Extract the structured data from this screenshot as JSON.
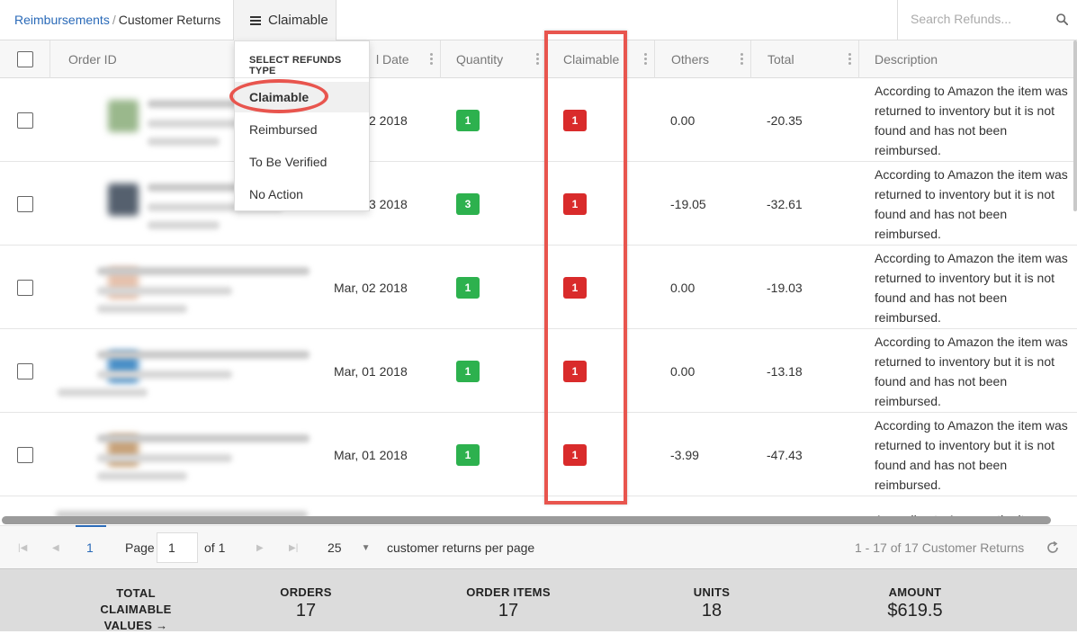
{
  "breadcrumb": {
    "parent": "Reimbursements",
    "separator": "/",
    "current": "Customer Returns"
  },
  "type_button": {
    "label": "Claimable"
  },
  "search": {
    "placeholder": "Search Refunds..."
  },
  "dropdown": {
    "title": "SELECT REFUNDS TYPE",
    "items": [
      "Claimable",
      "Reimbursed",
      "To Be Verified",
      "No Action"
    ],
    "selected": "Claimable"
  },
  "columns": {
    "order_id": "Order ID",
    "date": "l Date",
    "quantity": "Quantity",
    "claimable": "Claimable",
    "others": "Others",
    "total": "Total",
    "description": "Description"
  },
  "rows": [
    {
      "date": "2 2018",
      "quantity": "1",
      "claimable": "1",
      "others": "0.00",
      "total": "-20.35",
      "description": "According to Amazon the item was returned to inventory but it is not found and has not been reimbursed."
    },
    {
      "date": "3 2018",
      "quantity": "3",
      "claimable": "1",
      "others": "-19.05",
      "total": "-32.61",
      "description": "According to Amazon the item was returned to inventory but it is not found and has not been reimbursed."
    },
    {
      "date": "Mar, 02 2018",
      "quantity": "1",
      "claimable": "1",
      "others": "0.00",
      "total": "-19.03",
      "description": "According to Amazon the item was returned to inventory but it is not found and has not been reimbursed."
    },
    {
      "date": "Mar, 01 2018",
      "quantity": "1",
      "claimable": "1",
      "others": "0.00",
      "total": "-13.18",
      "description": "According to Amazon the item was returned to inventory but it is not found and has not been reimbursed."
    },
    {
      "date": "Mar, 01 2018",
      "quantity": "1",
      "claimable": "1",
      "others": "-3.99",
      "total": "-47.43",
      "description": "According to Amazon the item was returned to inventory but it is not found and has not been reimbursed."
    }
  ],
  "partial_row": {
    "description": "According to Amazon the item was"
  },
  "pagination": {
    "current_page": "1",
    "page_label": "Page",
    "page_input": "1",
    "of_label": "of 1",
    "per_page": "25",
    "per_page_label": "customer returns per page",
    "range_text": "1 - 17 of 17 Customer Returns"
  },
  "summary": {
    "title": "TOTAL CLAIMABLE VALUES →",
    "title_lines": [
      "TOTAL",
      "CLAIMABLE",
      "VALUES →"
    ],
    "orders_label": "ORDERS",
    "orders_value": "17",
    "order_items_label": "ORDER ITEMS",
    "order_items_value": "17",
    "units_label": "UNITS",
    "units_value": "18",
    "amount_label": "AMOUNT",
    "amount_value": "$619.5"
  },
  "colors": {
    "link": "#2a6ab8",
    "badge_green": "#2db14e",
    "badge_red": "#d92b2b",
    "highlight": "#e8554e"
  },
  "icons": [
    "menu-icon",
    "search-icon",
    "column-menu-icon",
    "first-page-icon",
    "prev-page-icon",
    "next-page-icon",
    "last-page-icon",
    "dropdown-caret-icon",
    "refresh-icon"
  ]
}
